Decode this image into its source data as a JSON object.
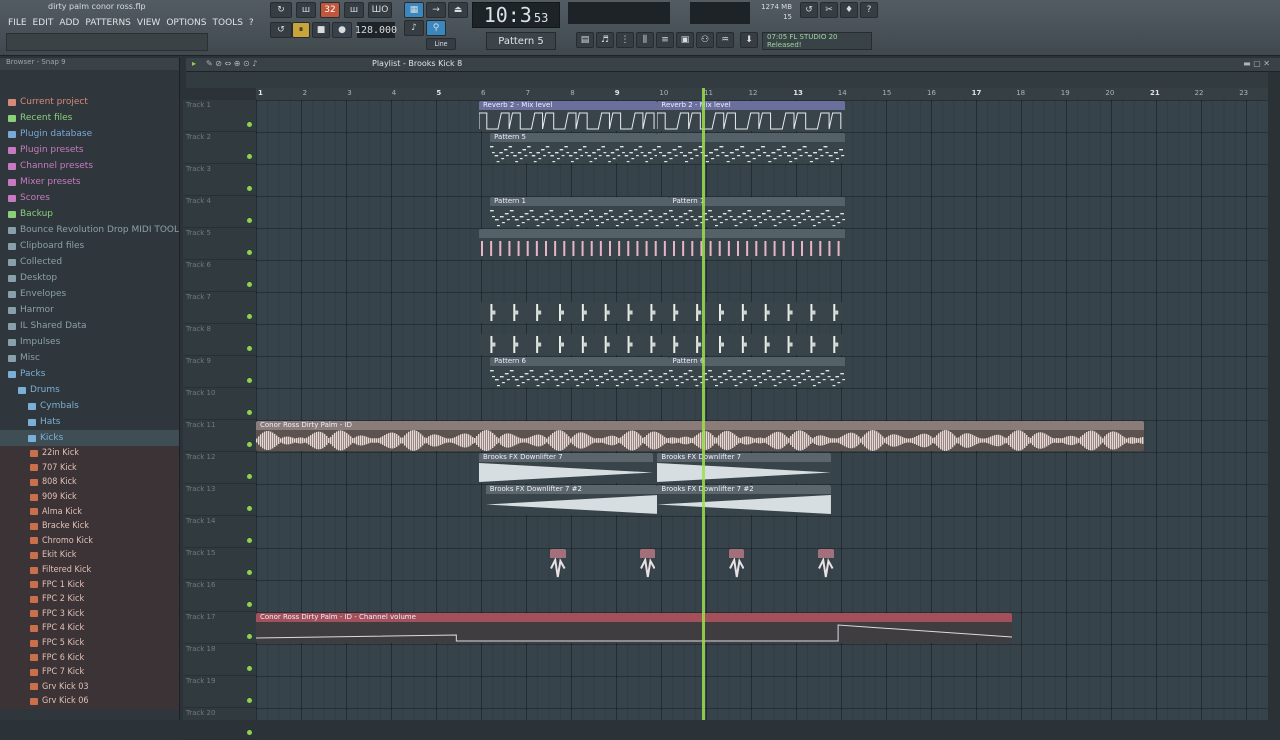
{
  "app": {
    "title": "dirty palm conor ross.flp",
    "menu": [
      "FILE",
      "EDIT",
      "ADD",
      "PATTERNS",
      "VIEW",
      "OPTIONS",
      "TOOLS",
      "?"
    ]
  },
  "transport": {
    "song_mode": "32",
    "tempo": "128.000",
    "time_main": "10:3",
    "time_sub": "53",
    "pattern": "Pattern 5",
    "snap": "Line",
    "cpu_mem": "1274 MB",
    "cpu_val": "33",
    "voices": "15",
    "news": "07:05  FL STUDIO 20 Released!"
  },
  "browser": {
    "header": "Browser - Snap 9",
    "items": [
      {
        "label": "Current project",
        "color": "#d88a7a",
        "depth": 0
      },
      {
        "label": "Recent files",
        "color": "#8ad07a",
        "depth": 0
      },
      {
        "label": "Plugin database",
        "color": "#7aa8d8",
        "depth": 0
      },
      {
        "label": "Plugin presets",
        "color": "#c87ac0",
        "depth": 0
      },
      {
        "label": "Channel presets",
        "color": "#c87ac0",
        "depth": 0
      },
      {
        "label": "Mixer presets",
        "color": "#c87ac0",
        "depth": 0
      },
      {
        "label": "Scores",
        "color": "#c87ac0",
        "depth": 0
      },
      {
        "label": "Backup",
        "color": "#8ad07a",
        "depth": 0
      },
      {
        "label": "Bounce Revolution Drop MIDI TOOLS",
        "color": "#8aa0a8",
        "depth": 0
      },
      {
        "label": "Clipboard files",
        "color": "#8aa0a8",
        "depth": 0
      },
      {
        "label": "Collected",
        "color": "#8aa0a8",
        "depth": 0
      },
      {
        "label": "Desktop",
        "color": "#8aa0a8",
        "depth": 0
      },
      {
        "label": "Envelopes",
        "color": "#8aa0a8",
        "depth": 0
      },
      {
        "label": "Harmor",
        "color": "#8aa0a8",
        "depth": 0
      },
      {
        "label": "IL Shared Data",
        "color": "#8aa0a8",
        "depth": 0
      },
      {
        "label": "Impulses",
        "color": "#8aa0a8",
        "depth": 0
      },
      {
        "label": "Misc",
        "color": "#8aa0a8",
        "depth": 0
      },
      {
        "label": "Packs",
        "color": "#7ab0d8",
        "depth": 0
      },
      {
        "label": "Drums",
        "color": "#7ab0d8",
        "depth": 1
      },
      {
        "label": "Cymbals",
        "color": "#7ab0d8",
        "depth": 2
      },
      {
        "label": "Hats",
        "color": "#7ab0d8",
        "depth": 2
      },
      {
        "label": "Kicks",
        "color": "#7ab0d8",
        "depth": 2
      }
    ],
    "files": [
      "22in Kick",
      "707 Kick",
      "808 Kick",
      "909 Kick",
      "Alma Kick",
      "Bracke Kick",
      "Chromo Kick",
      "Ekit Kick",
      "Filtered Kick",
      "FPC 1 Kick",
      "FPC 2 Kick",
      "FPC 3 Kick",
      "FPC 4 Kick",
      "FPC 5 Kick",
      "FPC 6 Kick",
      "FPC 7 Kick",
      "Grv Kick 03",
      "Grv Kick 06"
    ]
  },
  "playlist": {
    "title": "Playlist - Brooks Kick 8",
    "ruler": [
      "1",
      "2",
      "3",
      "4",
      "5",
      "6",
      "7",
      "8",
      "9",
      "10",
      "11",
      "12",
      "13",
      "14",
      "15",
      "16",
      "17",
      "18",
      "19",
      "20",
      "21",
      "22",
      "23"
    ],
    "tracks": [
      "Track 1",
      "Track 2",
      "Track 3",
      "Track 4",
      "Track 5",
      "Track 6",
      "Track 7",
      "Track 8",
      "Track 9",
      "Track 10",
      "Track 11",
      "Track 12",
      "Track 13",
      "Track 14",
      "Track 15",
      "Track 16",
      "Track 17",
      "Track 18",
      "Track 19",
      "Track 20"
    ],
    "clips": [
      {
        "label": "Reverb 2 - Mix level",
        "track": 0,
        "start": 5.0,
        "len": 4.0,
        "kind": "auto",
        "color": "#6a6f9c"
      },
      {
        "label": "Reverb 2 - Mix level",
        "track": 0,
        "start": 9.0,
        "len": 4.2,
        "kind": "auto",
        "color": "#6a6f9c"
      },
      {
        "label": "Pattern 5",
        "track": 1,
        "start": 5.25,
        "len": 3.75,
        "kind": "notes",
        "color": "#556168"
      },
      {
        "label": "",
        "track": 1,
        "start": 9.0,
        "len": 4.2,
        "kind": "notes",
        "color": "#556168"
      },
      {
        "label": "Pattern 1",
        "track": 3,
        "start": 5.25,
        "len": 4.0,
        "kind": "notes",
        "color": "#556168"
      },
      {
        "label": "Pattern 1",
        "track": 3,
        "start": 9.25,
        "len": 3.95,
        "kind": "notes",
        "color": "#556168"
      },
      {
        "label": "",
        "track": 4,
        "start": 5.0,
        "len": 8.2,
        "kind": "pink",
        "color": "#556168"
      },
      {
        "label": "",
        "track": 6,
        "start": 5.0,
        "len": 8.2,
        "kind": "hits",
        "color": "#3c474d"
      },
      {
        "label": "",
        "track": 7,
        "start": 5.0,
        "len": 8.2,
        "kind": "hits",
        "color": "#3c474d"
      },
      {
        "label": "Pattern 6",
        "track": 8,
        "start": 5.25,
        "len": 4.0,
        "kind": "notes",
        "color": "#556168"
      },
      {
        "label": "Pattern 6",
        "track": 8,
        "start": 9.25,
        "len": 3.95,
        "kind": "notes",
        "color": "#556168"
      },
      {
        "label": "Conor Ross  Dirty Palm - ID",
        "track": 10,
        "start": 0.0,
        "len": 19.9,
        "kind": "audio",
        "color": "#8a7c78"
      },
      {
        "label": "Brooks FX Downlifter 7",
        "track": 11,
        "start": 5.0,
        "len": 3.9,
        "kind": "down",
        "color": "#5a666c"
      },
      {
        "label": "Brooks FX Downlifter 7",
        "track": 11,
        "start": 9.0,
        "len": 3.9,
        "kind": "down",
        "color": "#5a666c"
      },
      {
        "label": "Brooks FX Downlifter 7 #2",
        "track": 12,
        "start": 5.15,
        "len": 3.85,
        "kind": "up",
        "color": "#5a666c"
      },
      {
        "label": "Brooks FX Downlifter 7 #2",
        "track": 12,
        "start": 9.0,
        "len": 3.9,
        "kind": "up",
        "color": "#5a666c"
      },
      {
        "label": "",
        "track": 14,
        "start": 6.6,
        "len": 0.35,
        "kind": "fx",
        "color": "#a36f7a"
      },
      {
        "label": "",
        "track": 14,
        "start": 8.6,
        "len": 0.35,
        "kind": "fx",
        "color": "#a36f7a"
      },
      {
        "label": "",
        "track": 14,
        "start": 10.6,
        "len": 0.35,
        "kind": "fx",
        "color": "#a36f7a"
      },
      {
        "label": "",
        "track": 14,
        "start": 12.6,
        "len": 0.35,
        "kind": "fx",
        "color": "#a36f7a"
      },
      {
        "label": "Conor Ross  Dirty Palm - ID - Channel volume",
        "track": 16,
        "start": 0.0,
        "len": 16.95,
        "kind": "vol",
        "color": "#a3505a"
      }
    ],
    "playhead_bar": 10.6
  },
  "colors": {
    "accent": "#9be04a",
    "play": "#c9a43a"
  }
}
